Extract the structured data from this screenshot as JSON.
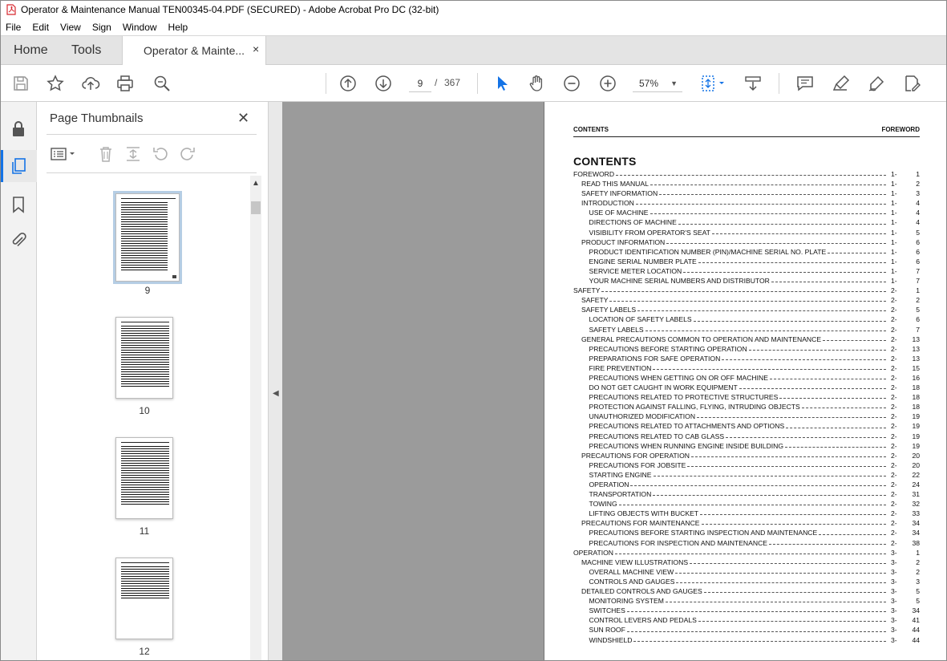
{
  "window": {
    "title": "Operator & Maintenance Manual TEN00345-04.PDF (SECURED) - Adobe Acrobat Pro DC (32-bit)"
  },
  "menu": [
    "File",
    "Edit",
    "View",
    "Sign",
    "Window",
    "Help"
  ],
  "tabs": {
    "home": "Home",
    "tools": "Tools",
    "doc": "Operator & Mainte...",
    "close": "×"
  },
  "toolbar": {
    "page_current": "9",
    "page_sep": "/",
    "page_total": "367",
    "zoom": "57%"
  },
  "thumbnails_panel": {
    "title": "Page Thumbnails",
    "close": "✕",
    "pages": [
      "9",
      "10",
      "11",
      "12"
    ]
  },
  "page": {
    "header_left": "CONTENTS",
    "header_right": "FOREWORD",
    "title": "CONTENTS",
    "toc": [
      {
        "t": "FOREWORD",
        "c": "1-",
        "n": "1",
        "lvl": 0
      },
      {
        "t": "READ THIS MANUAL",
        "c": "1-",
        "n": "2",
        "lvl": 1
      },
      {
        "t": "SAFETY INFORMATION",
        "c": "1-",
        "n": "3",
        "lvl": 1
      },
      {
        "t": "INTRODUCTION",
        "c": "1-",
        "n": "4",
        "lvl": 1
      },
      {
        "t": "USE OF MACHINE",
        "c": "1-",
        "n": "4",
        "lvl": 2
      },
      {
        "t": "DIRECTIONS OF MACHINE",
        "c": "1-",
        "n": "4",
        "lvl": 2
      },
      {
        "t": "VISIBILITY FROM OPERATOR'S SEAT",
        "c": "1-",
        "n": "5",
        "lvl": 2
      },
      {
        "t": "PRODUCT INFORMATION",
        "c": "1-",
        "n": "6",
        "lvl": 1
      },
      {
        "t": "PRODUCT IDENTIFICATION NUMBER (PIN)/MACHINE SERIAL NO. PLATE",
        "c": "1-",
        "n": "6",
        "lvl": 2
      },
      {
        "t": "ENGINE SERIAL NUMBER PLATE",
        "c": "1-",
        "n": "6",
        "lvl": 2
      },
      {
        "t": "SERVICE METER LOCATION",
        "c": "1-",
        "n": "7",
        "lvl": 2
      },
      {
        "t": "YOUR MACHINE SERIAL NUMBERS AND DISTRIBUTOR",
        "c": "1-",
        "n": "7",
        "lvl": 2
      },
      {
        "t": "SAFETY",
        "c": "2-",
        "n": "1",
        "lvl": 0
      },
      {
        "t": "SAFETY",
        "c": "2-",
        "n": "2",
        "lvl": 1
      },
      {
        "t": "SAFETY LABELS",
        "c": "2-",
        "n": "5",
        "lvl": 1
      },
      {
        "t": "LOCATION OF SAFETY LABELS",
        "c": "2-",
        "n": "6",
        "lvl": 2
      },
      {
        "t": "SAFETY LABELS",
        "c": "2-",
        "n": "7",
        "lvl": 2
      },
      {
        "t": "GENERAL PRECAUTIONS COMMON TO OPERATION AND MAINTENANCE",
        "c": "2-",
        "n": "13",
        "lvl": 1
      },
      {
        "t": "PRECAUTIONS BEFORE STARTING OPERATION",
        "c": "2-",
        "n": "13",
        "lvl": 2
      },
      {
        "t": "PREPARATIONS FOR SAFE OPERATION",
        "c": "2-",
        "n": "13",
        "lvl": 2
      },
      {
        "t": "FIRE PREVENTION",
        "c": "2-",
        "n": "15",
        "lvl": 2
      },
      {
        "t": "PRECAUTIONS WHEN GETTING ON OR OFF MACHINE",
        "c": "2-",
        "n": "16",
        "lvl": 2
      },
      {
        "t": "DO NOT GET CAUGHT IN WORK EQUIPMENT",
        "c": "2-",
        "n": "18",
        "lvl": 2
      },
      {
        "t": "PRECAUTIONS RELATED TO PROTECTIVE STRUCTURES",
        "c": "2-",
        "n": "18",
        "lvl": 2
      },
      {
        "t": "PROTECTION AGAINST FALLING, FLYING, INTRUDING OBJECTS",
        "c": "2-",
        "n": "18",
        "lvl": 2
      },
      {
        "t": "UNAUTHORIZED MODIFICATION",
        "c": "2-",
        "n": "19",
        "lvl": 2
      },
      {
        "t": "PRECAUTIONS RELATED TO ATTACHMENTS AND OPTIONS",
        "c": "2-",
        "n": "19",
        "lvl": 2
      },
      {
        "t": "PRECAUTIONS RELATED TO CAB GLASS",
        "c": "2-",
        "n": "19",
        "lvl": 2
      },
      {
        "t": "PRECAUTIONS WHEN RUNNING ENGINE INSIDE BUILDING",
        "c": "2-",
        "n": "19",
        "lvl": 2
      },
      {
        "t": "PRECAUTIONS FOR OPERATION",
        "c": "2-",
        "n": "20",
        "lvl": 1
      },
      {
        "t": "PRECAUTIONS FOR JOBSITE",
        "c": "2-",
        "n": "20",
        "lvl": 2
      },
      {
        "t": "STARTING ENGINE",
        "c": "2-",
        "n": "22",
        "lvl": 2
      },
      {
        "t": "OPERATION",
        "c": "2-",
        "n": "24",
        "lvl": 2
      },
      {
        "t": "TRANSPORTATION",
        "c": "2-",
        "n": "31",
        "lvl": 2
      },
      {
        "t": "TOWING",
        "c": "2-",
        "n": "32",
        "lvl": 2
      },
      {
        "t": "LIFTING OBJECTS WITH BUCKET",
        "c": "2-",
        "n": "33",
        "lvl": 2
      },
      {
        "t": "PRECAUTIONS FOR MAINTENANCE",
        "c": "2-",
        "n": "34",
        "lvl": 1
      },
      {
        "t": "PRECAUTIONS BEFORE STARTING INSPECTION AND MAINTENANCE",
        "c": "2-",
        "n": "34",
        "lvl": 2
      },
      {
        "t": "PRECAUTIONS FOR INSPECTION AND MAINTENANCE",
        "c": "2-",
        "n": "38",
        "lvl": 2
      },
      {
        "t": "OPERATION",
        "c": "3-",
        "n": "1",
        "lvl": 0
      },
      {
        "t": "MACHINE VIEW ILLUSTRATIONS",
        "c": "3-",
        "n": "2",
        "lvl": 1
      },
      {
        "t": "OVERALL MACHINE VIEW",
        "c": "3-",
        "n": "2",
        "lvl": 2
      },
      {
        "t": "CONTROLS AND GAUGES",
        "c": "3-",
        "n": "3",
        "lvl": 2
      },
      {
        "t": "DETAILED CONTROLS AND GAUGES",
        "c": "3-",
        "n": "5",
        "lvl": 1
      },
      {
        "t": "MONITORING SYSTEM",
        "c": "3-",
        "n": "5",
        "lvl": 2
      },
      {
        "t": "SWITCHES",
        "c": "3-",
        "n": "34",
        "lvl": 2
      },
      {
        "t": "CONTROL LEVERS AND PEDALS",
        "c": "3-",
        "n": "41",
        "lvl": 2
      },
      {
        "t": "SUN ROOF",
        "c": "3-",
        "n": "44",
        "lvl": 2
      },
      {
        "t": "WINDSHIELD",
        "c": "3-",
        "n": "44",
        "lvl": 2
      }
    ]
  },
  "colors": {
    "accent": "#1473e6",
    "pdf_red": "#d7282f",
    "doc_bg": "#9b9b9b",
    "tabbar_bg": "#e4e4e4"
  }
}
